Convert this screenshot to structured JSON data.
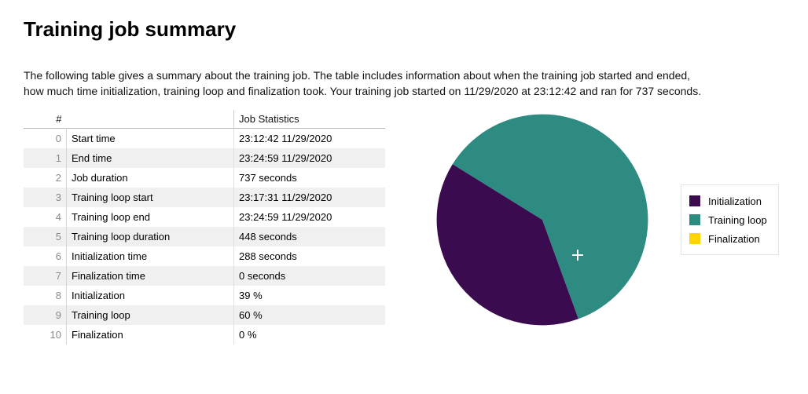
{
  "title": "Training job summary",
  "description": "The following table gives a summary about the training job. The table includes information about when the training job started and ended, how much time initialization, training loop and finalization took. Your training job started on 11/29/2020 at 23:12:42 and ran for 737 seconds.",
  "table": {
    "index_header": "#",
    "col0_header": "",
    "col1_header": "Job Statistics",
    "rows": [
      {
        "idx": "0",
        "k": "Start time",
        "v": "23:12:42 11/29/2020"
      },
      {
        "idx": "1",
        "k": "End time",
        "v": "23:24:59 11/29/2020"
      },
      {
        "idx": "2",
        "k": "Job duration",
        "v": "737 seconds"
      },
      {
        "idx": "3",
        "k": "Training loop start",
        "v": "23:17:31 11/29/2020"
      },
      {
        "idx": "4",
        "k": "Training loop end",
        "v": "23:24:59 11/29/2020"
      },
      {
        "idx": "5",
        "k": "Training loop duration",
        "v": "448 seconds"
      },
      {
        "idx": "6",
        "k": "Initialization time",
        "v": "288 seconds"
      },
      {
        "idx": "7",
        "k": "Finalization time",
        "v": "0 seconds"
      },
      {
        "idx": "8",
        "k": "Initialization",
        "v": "39 %"
      },
      {
        "idx": "9",
        "k": "Training loop",
        "v": "60 %"
      },
      {
        "idx": "10",
        "k": "Finalization",
        "v": "0 %"
      }
    ]
  },
  "colors": {
    "initialization": "#3a0b4e",
    "training_loop": "#2e8b82",
    "finalization": "#ffd400"
  },
  "chart_data": {
    "type": "pie",
    "title": "",
    "categories": [
      "Initialization",
      "Training loop",
      "Finalization"
    ],
    "values": [
      39,
      60,
      0
    ],
    "colors": [
      "#3a0b4e",
      "#2e8b82",
      "#ffd400"
    ],
    "legend_position": "right",
    "start_angle_deg": 70
  }
}
